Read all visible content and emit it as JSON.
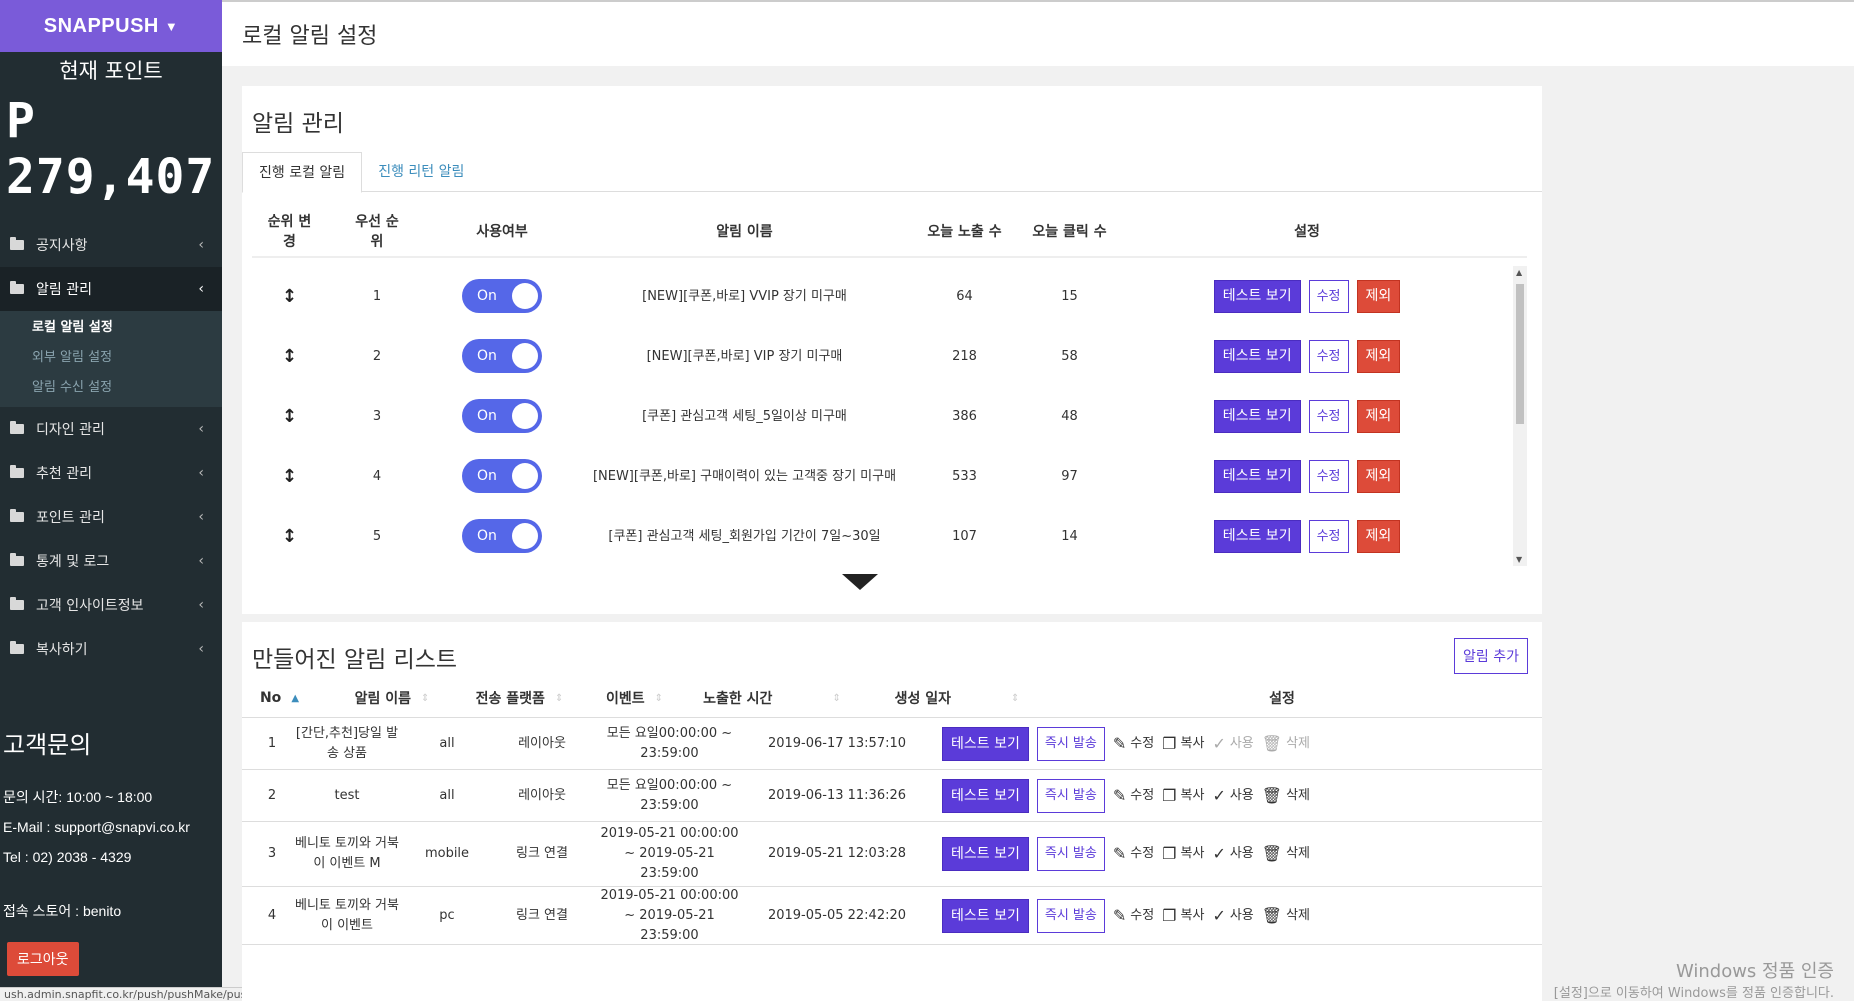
{
  "sidebar": {
    "brand": "SNAPPUSH",
    "points_label": "현재 포인트",
    "points_value": "P 279,407",
    "menu": [
      {
        "label": "공지사항"
      },
      {
        "label": "알림 관리"
      },
      {
        "label": "디자인 관리"
      },
      {
        "label": "추천 관리"
      },
      {
        "label": "포인트 관리"
      },
      {
        "label": "통계 및 로그"
      },
      {
        "label": "고객 인사이트정보"
      },
      {
        "label": "복사하기"
      }
    ],
    "submenu": [
      "로컬 알림 설정",
      "외부 알림 설정",
      "알림 수신 설정"
    ],
    "contact_title": "고객문의",
    "contact_hours": "문의 시간: 10:00 ~ 18:00",
    "contact_email": "E-Mail : support@snapvi.co.kr",
    "contact_tel": "Tel : 02) 2038 - 4329",
    "store": "접속 스토어 : benito",
    "logout": "로그아웃",
    "status_url": "ush.admin.snapfit.co.kr/push/pushMake/pushMade"
  },
  "header": {
    "title": "로컬 알림 설정"
  },
  "alarm_panel": {
    "title": "알림 관리",
    "tabs": [
      "진행 로컬 알림",
      "진행 리턴 알림"
    ],
    "columns": [
      "순위 변경",
      "우선 순위",
      "사용여부",
      "알림 이름",
      "오늘 노출 수",
      "오늘 클릭 수",
      "설정"
    ],
    "rows": [
      {
        "rank": "1",
        "use": "On",
        "name": "[NEW][쿠폰,바로] VVIP 장기 미구매",
        "views": "64",
        "clicks": "15"
      },
      {
        "rank": "2",
        "use": "On",
        "name": "[NEW][쿠폰,바로] VIP 장기 미구매",
        "views": "218",
        "clicks": "58"
      },
      {
        "rank": "3",
        "use": "On",
        "name": "[쿠폰] 관심고객 세팅_5일이상 미구매",
        "views": "386",
        "clicks": "48"
      },
      {
        "rank": "4",
        "use": "On",
        "name": "[NEW][쿠폰,바로] 구매이력이 있는 고객중 장기 미구매",
        "views": "533",
        "clicks": "97"
      },
      {
        "rank": "5",
        "use": "On",
        "name": "[쿠폰] 관심고객 세팅_회원가입 기간이 7일~30일",
        "views": "107",
        "clicks": "14"
      }
    ],
    "btn_test": "테스트 보기",
    "btn_edit": "수정",
    "btn_exclude": "제외"
  },
  "list_panel": {
    "title": "만들어진 알림 리스트",
    "add_button": "알림 추가",
    "columns": [
      "No",
      "알림 이름",
      "전송 플랫폼",
      "이벤트",
      "노출한 시간",
      "생성 일자",
      "설정"
    ],
    "rows": [
      {
        "no": "1",
        "name": "[간단,추천]당일 발송 상품",
        "platform": "all",
        "event": "레이아웃",
        "time": "모든 요일00:00:00 ~ 23:59:00",
        "created": "2019-06-17 13:57:10"
      },
      {
        "no": "2",
        "name": "test",
        "platform": "all",
        "event": "레이아웃",
        "time": "모든 요일00:00:00 ~ 23:59:00",
        "created": "2019-06-13 11:36:26"
      },
      {
        "no": "3",
        "name": "베니토 토끼와 거북이 이벤트 M",
        "platform": "mobile",
        "event": "링크 연결",
        "time": "2019-05-21 00:00:00 ~ 2019-05-21 23:59:00",
        "created": "2019-05-21 12:03:28"
      },
      {
        "no": "4",
        "name": "베니토 토끼와 거북이 이벤트",
        "platform": "pc",
        "event": "링크 연결",
        "time": "2019-05-21 00:00:00 ~ 2019-05-21 23:59:00",
        "created": "2019-05-05 22:42:20"
      }
    ],
    "btn_test": "테스트 보기",
    "btn_send": "즉시 발송",
    "act_edit": "수정",
    "act_copy": "복사",
    "act_use": "사용",
    "act_delete": "삭제"
  },
  "watermark": {
    "line1": "Windows 정품 인증",
    "line2": "[설정]으로 이동하여 Windows를 정품 인증합니다."
  },
  "colors": {
    "sidebar_bg": "#222d32",
    "brand_bg": "#7a5bd9",
    "toggle_on": "#5567e8",
    "primary": "#5b3bd9",
    "danger": "#dd4b39"
  }
}
